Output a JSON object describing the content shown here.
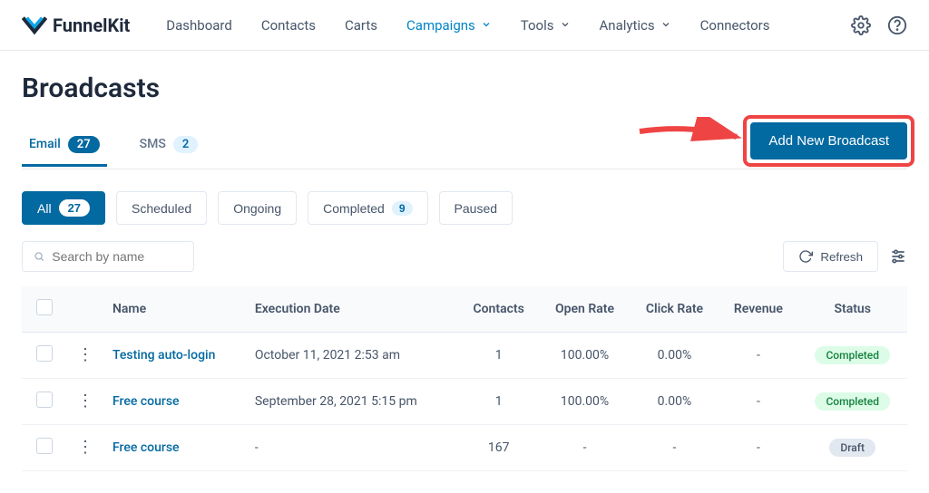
{
  "brand": "FunnelKit",
  "nav": {
    "items": [
      {
        "label": "Dashboard",
        "has_chevron": false
      },
      {
        "label": "Contacts",
        "has_chevron": false
      },
      {
        "label": "Carts",
        "has_chevron": false
      },
      {
        "label": "Campaigns",
        "has_chevron": true,
        "active": true
      },
      {
        "label": "Tools",
        "has_chevron": true
      },
      {
        "label": "Analytics",
        "has_chevron": true
      },
      {
        "label": "Connectors",
        "has_chevron": false
      }
    ]
  },
  "page_title": "Broadcasts",
  "tabs": [
    {
      "label": "Email",
      "count": "27",
      "active": true
    },
    {
      "label": "SMS",
      "count": "2",
      "active": false
    }
  ],
  "add_button": "Add New Broadcast",
  "filters": [
    {
      "label": "All",
      "count": "27",
      "active": true
    },
    {
      "label": "Scheduled"
    },
    {
      "label": "Ongoing"
    },
    {
      "label": "Completed",
      "count": "9"
    },
    {
      "label": "Paused"
    }
  ],
  "search_placeholder": "Search by name",
  "refresh_label": "Refresh",
  "table": {
    "headers": [
      "",
      "",
      "Name",
      "Execution Date",
      "Contacts",
      "Open Rate",
      "Click Rate",
      "Revenue",
      "Status"
    ],
    "rows": [
      {
        "name": "Testing auto-login",
        "date": "October 11, 2021 2:53 am",
        "contacts": "1",
        "open": "100.00%",
        "click": "0.00%",
        "revenue": "-",
        "status": "Completed",
        "status_class": "completed"
      },
      {
        "name": "Free course",
        "date": "September 28, 2021 5:15 pm",
        "contacts": "1",
        "open": "100.00%",
        "click": "0.00%",
        "revenue": "-",
        "status": "Completed",
        "status_class": "completed"
      },
      {
        "name": "Free course",
        "date": "-",
        "contacts": "167",
        "open": "-",
        "click": "-",
        "revenue": "-",
        "status": "Draft",
        "status_class": "draft"
      }
    ]
  }
}
